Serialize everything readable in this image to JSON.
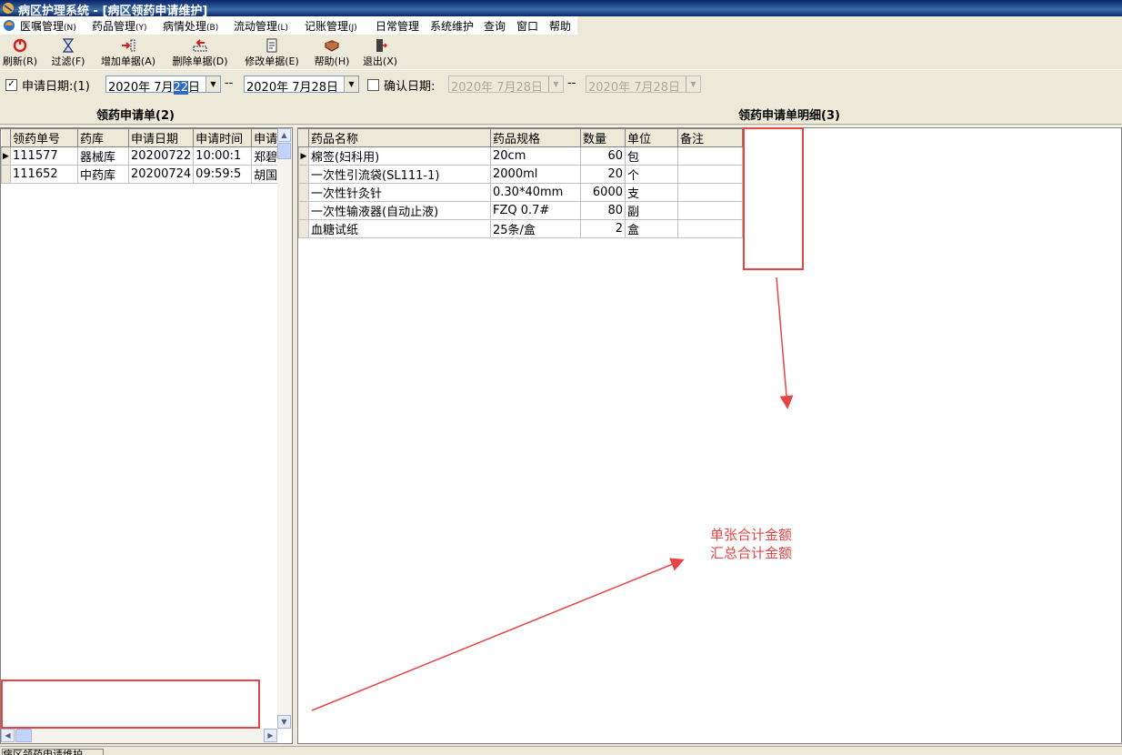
{
  "window": {
    "title": "病区护理系统 - [病区领药申请维护]"
  },
  "menu": [
    {
      "label": "医嘱管理",
      "key": "(N)"
    },
    {
      "label": "药品管理",
      "key": "(Y)"
    },
    {
      "label": "病情处理",
      "key": "(B)"
    },
    {
      "label": "流动管理",
      "key": "(L)"
    },
    {
      "label": "记账管理",
      "key": "(J)"
    },
    {
      "label": "日常管理",
      "key": ""
    },
    {
      "label": "系统维护",
      "key": ""
    },
    {
      "label": "查询",
      "key": ""
    },
    {
      "label": "窗口",
      "key": ""
    },
    {
      "label": "帮助",
      "key": ""
    }
  ],
  "toolbar": [
    {
      "label": "刷新(R)",
      "icon": "refresh-icon"
    },
    {
      "label": "过滤(F)",
      "icon": "hourglass-icon"
    },
    {
      "label": "增加单据(A)",
      "icon": "add-document-icon"
    },
    {
      "label": "删除单据(D)",
      "icon": "delete-document-icon"
    },
    {
      "label": "修改单据(E)",
      "icon": "edit-document-icon"
    },
    {
      "label": "帮助(H)",
      "icon": "help-book-icon"
    },
    {
      "label": "退出(X)",
      "icon": "exit-door-icon"
    }
  ],
  "filter": {
    "apply_checked": true,
    "apply_label": "申请日期:(1)",
    "apply_from": {
      "pre": "2020年  7月",
      "sel": "22",
      "post": "日"
    },
    "apply_to": "2020年  7月28日",
    "confirm_checked": false,
    "confirm_label": "确认日期:",
    "confirm_from": "2020年  7月28日",
    "confirm_to": "2020年  7月28日",
    "separator": "--"
  },
  "left": {
    "title": "领药申请单(2)",
    "columns": [
      "领药单号",
      "药库",
      "申请日期",
      "申请时间",
      "申请"
    ],
    "rows": [
      [
        "111577",
        "器械库",
        "20200722",
        "10:00:1",
        "郑碧"
      ],
      [
        "111652",
        "中药库",
        "20200724",
        "09:59:5",
        "胡国"
      ]
    ]
  },
  "right": {
    "title": "领药申请单明细(3)",
    "columns": [
      "药品名称",
      "药品规格",
      "数量",
      "单位",
      "备注"
    ],
    "rows": [
      [
        "棉签(妇科用)",
        "20cm",
        "60",
        "包",
        ""
      ],
      [
        "一次性引流袋(SL111-1)",
        "2000ml",
        "20",
        "个",
        ""
      ],
      [
        "一次性针灸针",
        "0.30*40mm",
        "6000",
        "支",
        ""
      ],
      [
        "一次性输液器(自动止液)",
        "FZQ 0.7#",
        "80",
        "副",
        ""
      ],
      [
        "血糖试纸",
        "25条/盒",
        "2",
        "盒",
        ""
      ]
    ]
  },
  "annotation": {
    "line1": "单张合计金额",
    "line2": "汇总合计金额",
    "color": "#e54545"
  },
  "status": {
    "tab": "病区领药申请维护"
  }
}
